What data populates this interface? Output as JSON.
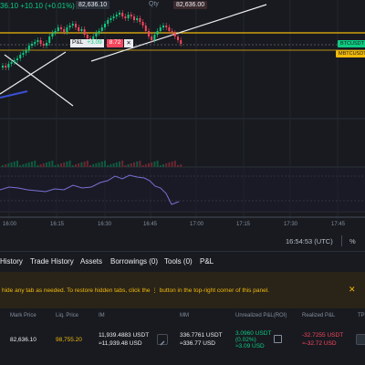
{
  "chart": {
    "ticker_text": "36.10 +10.10 (+0.01%)",
    "top_price_left": "82,636.10",
    "top_price_right": "82,636.00",
    "top_mid_label": "Qty",
    "pnl_label": "P&L",
    "pnl_value": "+3.09",
    "pnl_qty": "8.72",
    "tag_green": "BTCUSDT",
    "tag_orange": "MBTCUSDT",
    "time_labels": [
      "16:00",
      "16:15",
      "16:30",
      "16:45",
      "17:00",
      "17:15",
      "17:30",
      "17:45"
    ],
    "colors": {
      "up": "#0ecb81",
      "down": "#f6465d",
      "yellow": "#f0b90b",
      "rsi": "#7b6fd6"
    }
  },
  "clock": {
    "time": "16:54:53 (UTC)",
    "log": "%"
  },
  "tabs": [
    "History",
    "Trade History",
    "Assets",
    "Borrowings (0)",
    "Tools (0)",
    "P&L"
  ],
  "notice": {
    "text_before": "hide any tab as needed. To restore hidden tabs, click the",
    "text_after": "button in the top-right corner of this panel.",
    "close": "✕"
  },
  "table": {
    "headers": [
      "Mark Price",
      "Liq. Price",
      "IM",
      "MM",
      "Unrealized P&L(ROI)",
      "Realized P&L",
      "TP"
    ],
    "row": {
      "mark_price": "82,636.10",
      "liq_price": "98,755.20",
      "im_usdt": "11,939.4883 USDT",
      "im_usd": "≈11,939.48 USD",
      "mm_usdt": "336.7761 USDT",
      "mm_usd": "≈336.77 USD",
      "upnl_usdt": "3.0960 USDT",
      "upnl_roi": "(0.02%)",
      "upnl_usd": "≈3.09 USD",
      "rpnl_usdt": "-32.7255 USDT",
      "rpnl_usd": "≈-32.72 USD"
    }
  }
}
